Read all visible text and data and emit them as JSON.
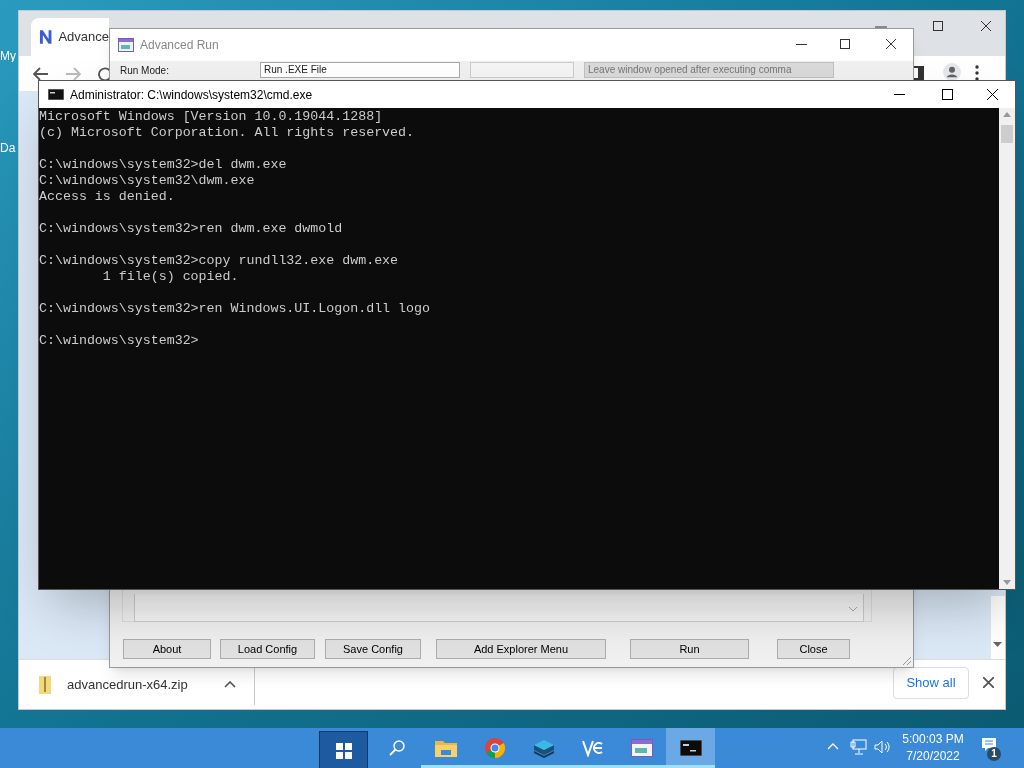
{
  "desktop_icons": [
    {
      "label": "My"
    },
    {
      "label": "Da"
    }
  ],
  "browser": {
    "tab_title": "Advance",
    "download_file": "advancedrun-x64.zip",
    "show_all": "Show all"
  },
  "advanced_run": {
    "title": "Advanced Run",
    "run_mode_label": "Run Mode:",
    "run_mode_value": "Run .EXE File",
    "leave_window": {
      "label": "Leave window opened after executing comma",
      "disabled": true
    },
    "buttons": [
      "About",
      "Load Config",
      "Save Config",
      "Add Explorer Menu",
      "Run",
      "Close"
    ]
  },
  "cmd": {
    "title": "Administrator: C:\\windows\\system32\\cmd.exe",
    "blocks": [
      [
        "Microsoft Windows [Version 10.0.19044.1288]",
        "(c) Microsoft Corporation. All rights reserved."
      ],
      [
        "C:\\windows\\system32>del dwm.exe",
        "C:\\windows\\system32\\dwm.exe",
        "Access is denied."
      ],
      [
        "C:\\windows\\system32>ren dwm.exe dwmold"
      ],
      [
        "C:\\windows\\system32>copy rundll32.exe dwm.exe",
        "        1 file(s) copied."
      ],
      [
        "C:\\windows\\system32>ren Windows.UI.Logon.dll logo"
      ],
      [
        "C:\\windows\\system32>"
      ]
    ]
  },
  "taskbar": {
    "apps": [
      {
        "kind": "start",
        "running": false,
        "selected": false
      },
      {
        "kind": "search",
        "running": false,
        "selected": false
      },
      {
        "kind": "folder",
        "running": true,
        "selected": false
      },
      {
        "kind": "chrome",
        "running": true,
        "selected": false
      },
      {
        "kind": "stack",
        "running": true,
        "selected": false
      },
      {
        "kind": "vs",
        "running": true,
        "selected": false
      },
      {
        "kind": "runapp",
        "running": true,
        "selected": false
      },
      {
        "kind": "console",
        "running": true,
        "selected": true
      }
    ],
    "time": "5:00:03 PM",
    "date": "7/20/2022",
    "notification_count": "1"
  }
}
